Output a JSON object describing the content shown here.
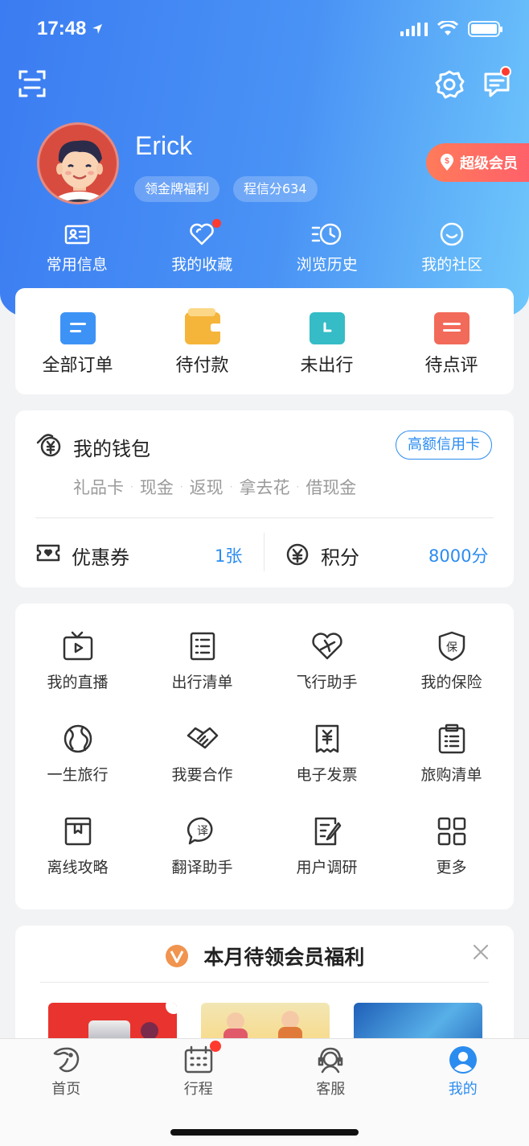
{
  "status_bar": {
    "time": "17:48"
  },
  "profile": {
    "username": "Erick",
    "tags": [
      "领金牌福利",
      "程信分634"
    ],
    "vip_label": "超级会员"
  },
  "quick_links": [
    {
      "label": "常用信息",
      "icon": "id-card-icon"
    },
    {
      "label": "我的收藏",
      "icon": "heart-icon",
      "has_dot": true
    },
    {
      "label": "浏览历史",
      "icon": "history-clock-icon"
    },
    {
      "label": "我的社区",
      "icon": "smile-chat-icon"
    }
  ],
  "orders": [
    {
      "label": "全部订单",
      "icon": "all-orders-icon",
      "color": "#3d93f5"
    },
    {
      "label": "待付款",
      "icon": "wallet-pay-icon",
      "color": "#f5b53a"
    },
    {
      "label": "未出行",
      "icon": "clock-ticket-icon",
      "color": "#35bcc6"
    },
    {
      "label": "待点评",
      "icon": "review-icon",
      "color": "#f26a5a"
    }
  ],
  "wallet": {
    "title": "我的钱包",
    "credit_button": "高额信用卡",
    "links": [
      "礼品卡",
      "现金",
      "返现",
      "拿去花",
      "借现金"
    ],
    "coupon_label": "优惠券",
    "coupon_value": "1张",
    "points_label": "积分",
    "points_value": "8000分"
  },
  "services": [
    {
      "label": "我的直播",
      "icon": "tv-live-icon"
    },
    {
      "label": "出行清单",
      "icon": "checklist-icon"
    },
    {
      "label": "飞行助手",
      "icon": "plane-heart-icon"
    },
    {
      "label": "我的保险",
      "icon": "shield-insurance-icon"
    },
    {
      "label": "一生旅行",
      "icon": "globe-icon"
    },
    {
      "label": "我要合作",
      "icon": "handshake-icon"
    },
    {
      "label": "电子发票",
      "icon": "invoice-icon"
    },
    {
      "label": "旅购清单",
      "icon": "clipboard-list-icon"
    },
    {
      "label": "离线攻略",
      "icon": "offline-guide-icon"
    },
    {
      "label": "翻译助手",
      "icon": "translate-bubble-icon"
    },
    {
      "label": "用户调研",
      "icon": "survey-edit-icon"
    },
    {
      "label": "更多",
      "icon": "grid-more-icon"
    }
  ],
  "benefits": {
    "title": "本月待领会员福利"
  },
  "tabbar": [
    {
      "label": "首页",
      "icon": "dolphin-home-icon",
      "active": false
    },
    {
      "label": "行程",
      "icon": "calendar-icon",
      "active": false,
      "has_dot": true
    },
    {
      "label": "客服",
      "icon": "headset-icon",
      "active": false
    },
    {
      "label": "我的",
      "icon": "user-profile-icon",
      "active": true
    }
  ],
  "colors": {
    "accent": "#2b8cf0",
    "hero_start": "#3b7cf2",
    "hero_end": "#6fc7fb",
    "badge_red": "#ff3b30",
    "vip_gradient_start": "#ff7b5a"
  }
}
